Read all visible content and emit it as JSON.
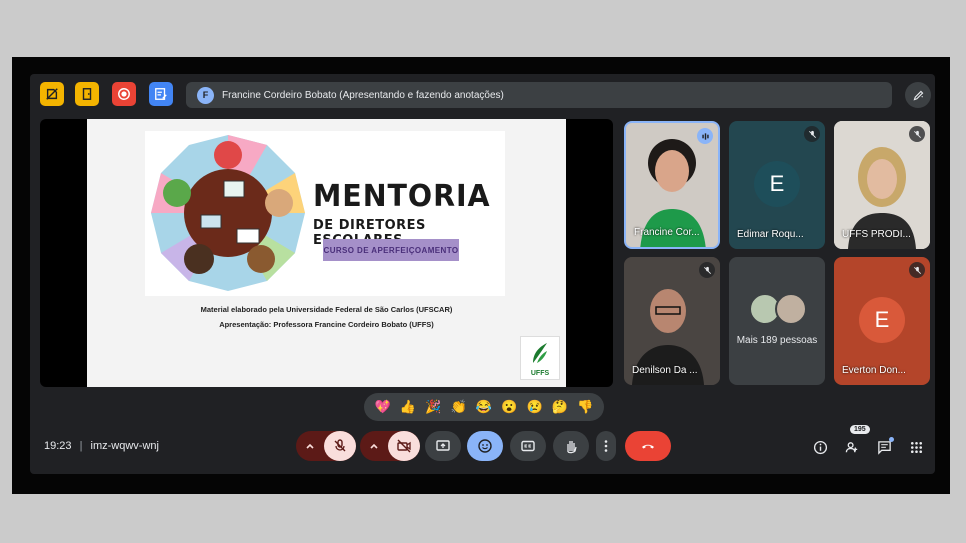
{
  "topbar": {
    "presenter_initial": "F",
    "presenter_banner": "Francine Cordeiro Bobato (Apresentando e fazendo anotações)"
  },
  "slide": {
    "title": "MENTORIA",
    "subtitle": "DE DIRETORES ESCOLARES",
    "course": "CURSO DE APERFEIÇOAMENTO",
    "line1": "Material elaborado pela Universidade Federal de São Carlos (UFSCAR)",
    "line2": "Apresentação: Professora Francine Cordeiro Bobato (UFFS)",
    "logo_text": "UFFS"
  },
  "participants": [
    {
      "name": "Francine Cor...",
      "speaking": true
    },
    {
      "name": "Edimar Roqu...",
      "initial": "E",
      "color": "#1e4e5a"
    },
    {
      "name": "UFFS PRODI..."
    },
    {
      "name": "Denilson Da ..."
    },
    {
      "name": "Mais 189 pessoas"
    },
    {
      "name": "Everton Don...",
      "initial": "E",
      "color": "#c1502e"
    }
  ],
  "reactions": [
    "💖",
    "👍",
    "🎉",
    "👏",
    "😂",
    "😮",
    "😢",
    "🤔",
    "👎"
  ],
  "bottombar": {
    "time": "19:23",
    "separator": "|",
    "meeting_code": "imz-wqwv-wnj",
    "people_count": "195"
  },
  "colors": {
    "accent_blue": "#8ab4f8",
    "end_call_red": "#ea4335",
    "background": "#202124"
  }
}
